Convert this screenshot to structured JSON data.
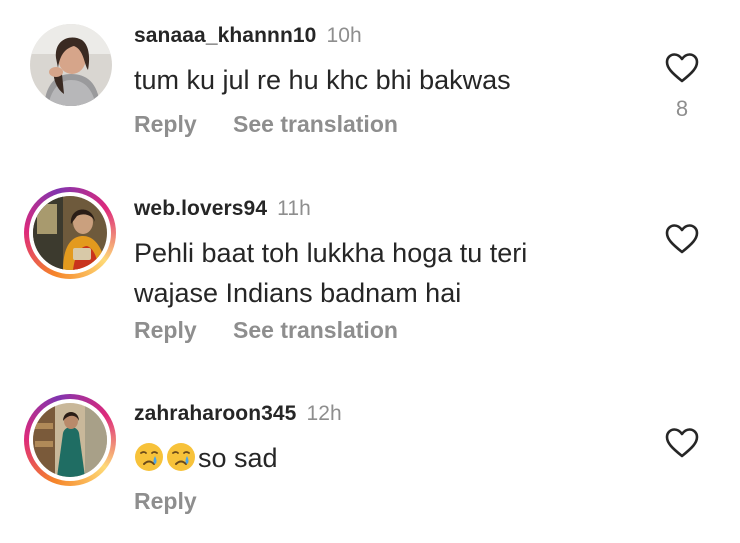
{
  "comments": [
    {
      "username": "sanaaa_khannn10",
      "time": "10h",
      "text": "tum ku jul re hu khc bhi bakwas",
      "reply": "Reply",
      "translate": "See translation",
      "likes": "8"
    },
    {
      "username": "web.lovers94",
      "time": "11h",
      "text_line1": "Pehli baat toh lukkha hoga tu teri",
      "text_line2": "wajase Indians badnam hai",
      "reply": "Reply",
      "translate": "See translation"
    },
    {
      "username": "zahraharoon345",
      "time": "12h",
      "text": "so sad",
      "emoji": "crying-face",
      "reply": "Reply"
    }
  ],
  "colors": {
    "text": "#262626",
    "secondary": "#8e8e8e",
    "story_ring": "#dd2a7b"
  }
}
